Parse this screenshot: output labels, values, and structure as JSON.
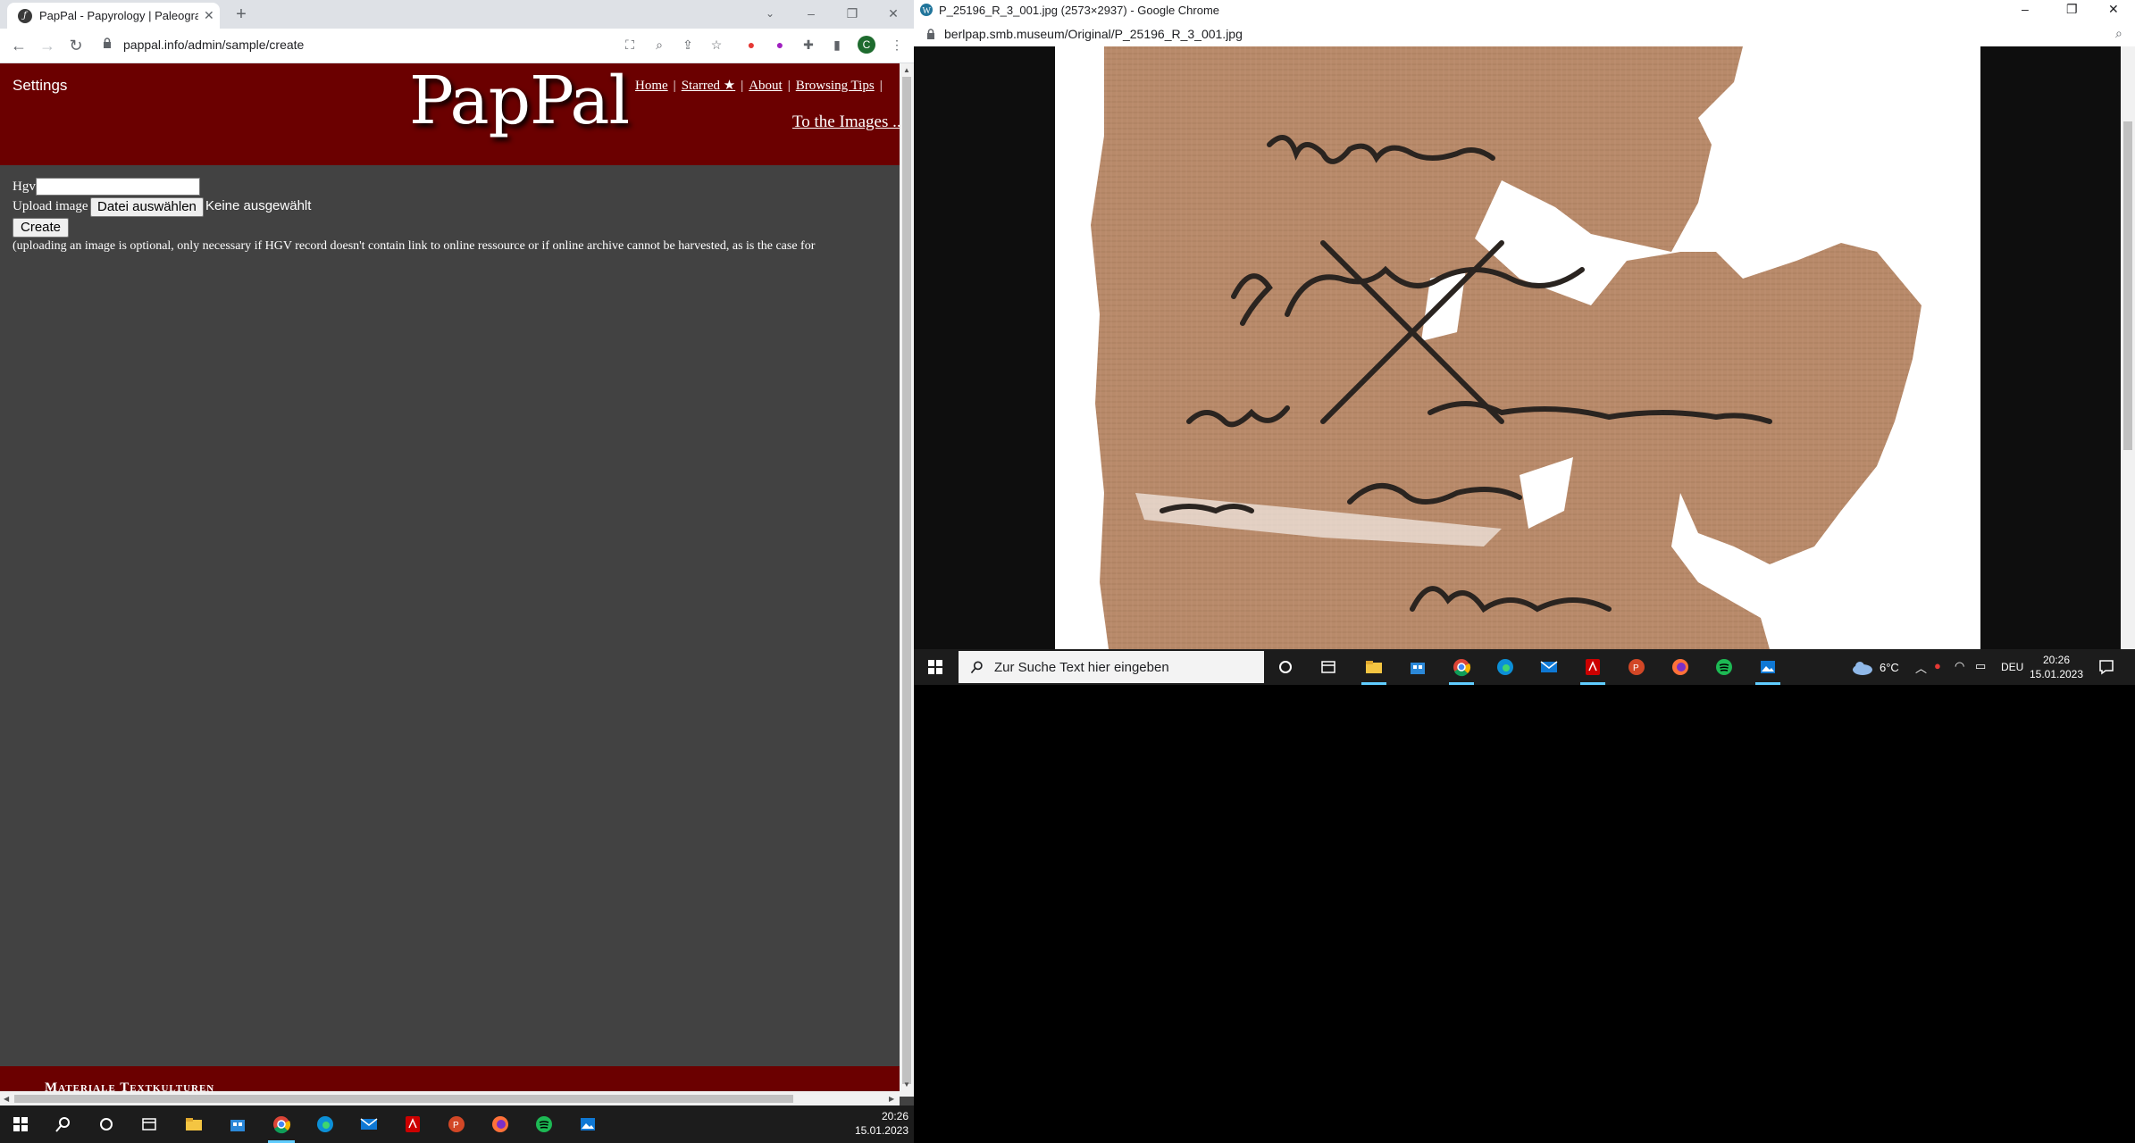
{
  "left_window": {
    "tab_title": "PapPal - Papyrology | Paleograph",
    "url": "pappal.info/admin/sample/create",
    "page": {
      "settings_label": "Settings",
      "logo": "PapPal",
      "nav": {
        "home": "Home",
        "starred": "Starred ★",
        "about": "About",
        "browsing_tips": "Browsing Tips"
      },
      "to_images": "To the Images ...",
      "form": {
        "hgv_label": "Hgv",
        "hgv_value": "",
        "upload_label": "Upload image",
        "file_button": "Datei auswählen",
        "file_status": "Keine ausgewählt",
        "create_button": "Create",
        "note": "(uploading an image is optional, only necessary if HGV record doesn't contain link to online ressource or if online archive cannot be harvested, as is the case for"
      },
      "footer": "Materiale Textkulturen"
    },
    "taskbar": {
      "time": "20:26",
      "date": "15.01.2023"
    }
  },
  "right_window": {
    "title": "P_25196_R_3_001.jpg (2573×2937) - Google Chrome",
    "url": "berlpap.smb.museum/Original/P_25196_R_3_001.jpg",
    "taskbar": {
      "search_placeholder": "Zur Suche Text hier eingeben",
      "temperature": "6°C",
      "language": "DEU",
      "time": "20:26",
      "date": "15.01.2023"
    }
  },
  "colors": {
    "site_maroon": "#6b0000",
    "page_gray": "#424242",
    "taskbar": "#1c1c1c",
    "papyrus": "#b88a6a"
  }
}
